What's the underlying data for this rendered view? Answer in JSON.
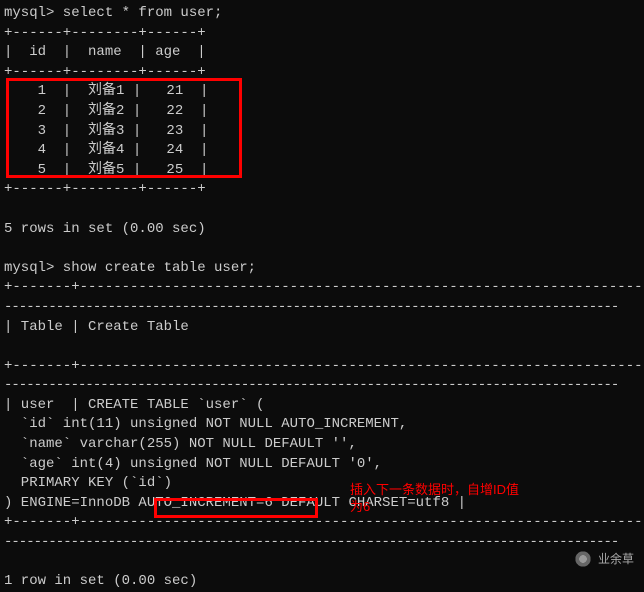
{
  "prompt1": "mysql> select * from user;",
  "table1": {
    "sep_top": "+------+--------+------+",
    "header": "|  id  |  name  | age  |",
    "sep_mid": "+------+--------+------+",
    "rows": [
      "|   1  |  刘备1 |   21  |",
      "|   2  |  刘备2 |   22  |",
      "|   3  |  刘备3 |   23  |",
      "|   4  |  刘备4 |   24  |",
      "|   5  |  刘备5 |   25  |"
    ],
    "sep_bot": "+------+--------+------+"
  },
  "result1": "5 rows in set (0.00 sec)",
  "prompt2": "mysql> show create table user;",
  "long_sep": "+-------+-----------------------------------------------------------------------",
  "long_dash": "-----------------------------------------------------------------------------------",
  "header2": "| Table | Create Table",
  "create": {
    "l1": "| user  | CREATE TABLE `user` (",
    "l2": "  `id` int(11) unsigned NOT NULL AUTO_INCREMENT,",
    "l3": "  `name` varchar(255) NOT NULL DEFAULT '',",
    "l4": "  `age` int(4) unsigned NOT NULL DEFAULT '0',",
    "l5": "  PRIMARY KEY (`id`)",
    "l6": ") ENGINE=InnoDB AUTO_INCREMENT=6 DEFAULT CHARSET=utf8 |"
  },
  "result2": "1 row in set (0.00 sec)",
  "annotation_line1": "插入下一条数据时，自增ID值",
  "annotation_line2": "为6",
  "watermark": "业余草",
  "chart_data": {
    "type": "table",
    "title": "user",
    "columns": [
      "id",
      "name",
      "age"
    ],
    "rows": [
      [
        1,
        "刘备1",
        21
      ],
      [
        2,
        "刘备2",
        22
      ],
      [
        3,
        "刘备3",
        23
      ],
      [
        4,
        "刘备4",
        24
      ],
      [
        5,
        "刘备5",
        25
      ]
    ],
    "auto_increment": 6,
    "engine": "InnoDB",
    "charset": "utf8"
  }
}
